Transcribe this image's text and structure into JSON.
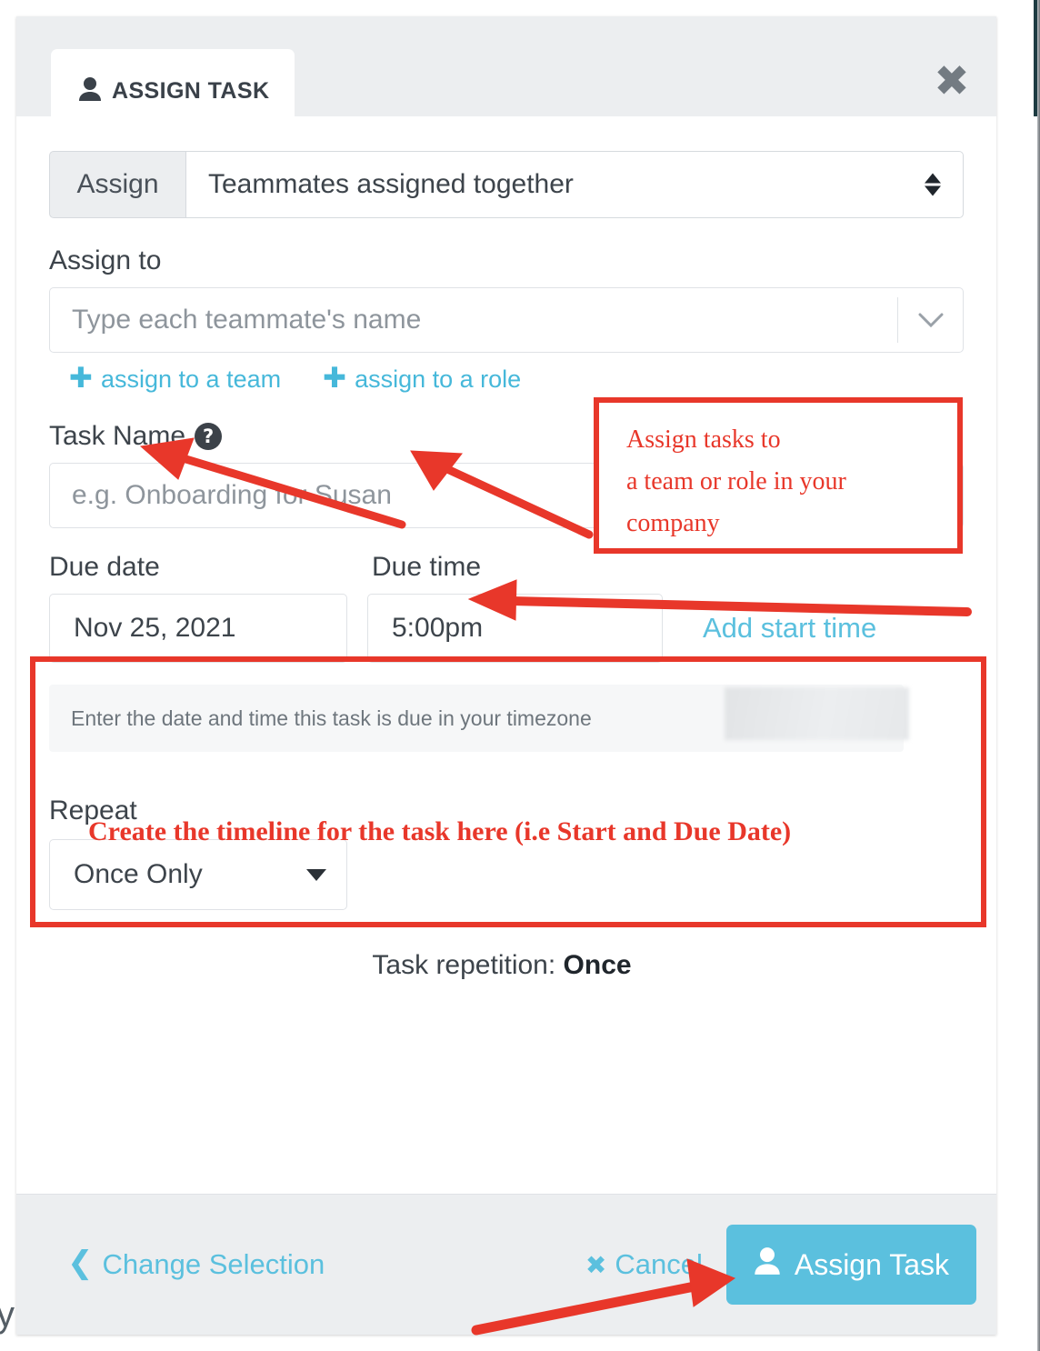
{
  "background": {
    "cut_off_text": "y"
  },
  "modal": {
    "tab": {
      "label": "ASSIGN TASK",
      "icon": "person-icon"
    },
    "close_icon": "✖",
    "assign_group": {
      "addon_label": "Assign",
      "selected_value": "Teammates assigned together",
      "options": [
        "Teammates assigned together"
      ]
    },
    "assign_to": {
      "label": "Assign to",
      "placeholder": "Type each teammate's name",
      "value": ""
    },
    "assign_links": [
      {
        "plus": "✚",
        "label": "assign to a team"
      },
      {
        "plus": "✚",
        "label": "assign to a role"
      }
    ],
    "task_name": {
      "label": "Task Name",
      "help_icon": "?",
      "placeholder": "e.g. Onboarding for Susan",
      "value": ""
    },
    "due": {
      "date_label": "Due date",
      "time_label": "Due time",
      "date_value": "Nov 25, 2021",
      "time_value": "5:00pm",
      "add_start_time_label": "Add start time",
      "help_text": "Enter the date and time this task is due in your timezone",
      "redacted_note": "timezone value redacted"
    },
    "repeat": {
      "label": "Repeat",
      "selected_value": "Once Only",
      "options": [
        "Once Only"
      ],
      "repetition_prefix": "Task repetition: ",
      "repetition_value": "Once"
    },
    "footer": {
      "change_selection_label": "Change Selection",
      "change_selection_chevron": "❮",
      "cancel_label": "Cancel",
      "cancel_x": "✖",
      "assign_task_label": "Assign Task"
    }
  },
  "annotations": {
    "team_role_note": "Assign tasks to\na team or role in your\ncompany",
    "timeline_note": "Create the timeline for the task here (i.e Start and Due Date)",
    "arrow_color": "#e8372a",
    "box_color": "#e8372a"
  },
  "colors": {
    "accent": "#5bc0de",
    "link": "#46b8da",
    "annotation_red": "#e8372a",
    "header_grey": "#eceef0",
    "text_dark": "#3d444b"
  }
}
